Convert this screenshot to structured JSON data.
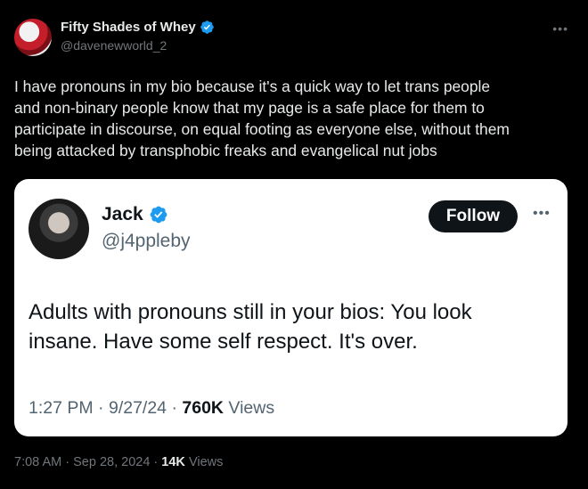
{
  "post": {
    "display_name": "Fifty Shades of Whey",
    "handle": "@davenewworld_2",
    "more_icon": "more-horizontal-icon",
    "text_lines": [
      "I have pronouns in my bio because it's a quick way to let trans people",
      "and non-binary people know that my page is a safe place for them to",
      "participate in discourse, on equal footing as everyone else, without them",
      "being attacked by transphobic freaks and evangelical nut jobs"
    ],
    "time": "7:08 AM",
    "date": "Sep 28, 2024",
    "views_count": "14K",
    "views_label": "Views",
    "separator": "·"
  },
  "quote": {
    "display_name": "Jack",
    "handle": "@j4ppleby",
    "follow_label": "Follow",
    "text_lines": [
      "Adults with pronouns still in your bios: You look",
      "insane. Have some self respect. It's over."
    ],
    "time": "1:27 PM",
    "date": "9/27/24",
    "views_count": "760K",
    "views_label": "Views",
    "separator": "·"
  },
  "colors": {
    "background": "#000000",
    "verified_blue": "#1d9bf0",
    "text_primary": "#e7e9ea",
    "text_secondary": "#71767b",
    "card_background": "#ffffff",
    "follow_button": "#0f1419"
  }
}
